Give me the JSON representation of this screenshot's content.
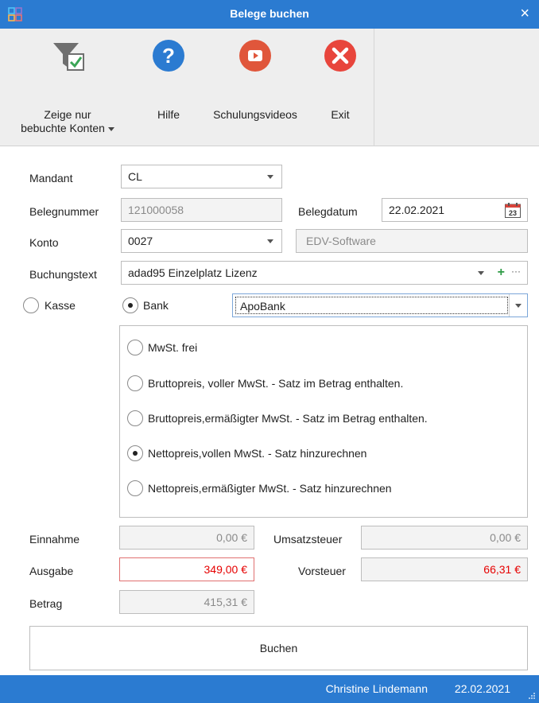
{
  "window": {
    "title": "Belege buchen",
    "close_glyph": "×"
  },
  "toolbar": {
    "show_booked": {
      "line1": "Zeige nur",
      "line2": "bebuchte Konten",
      "icon": "filter-check-icon"
    },
    "help": {
      "label": "Hilfe",
      "icon": "help-icon"
    },
    "videos": {
      "label": "Schulungsvideos",
      "icon": "video-play-icon"
    },
    "exit": {
      "label": "Exit",
      "icon": "exit-icon"
    }
  },
  "form": {
    "mandant": {
      "label": "Mandant",
      "value": "CL"
    },
    "belegnummer": {
      "label": "Belegnummer",
      "value": "121000058"
    },
    "belegdatum": {
      "label": "Belegdatum",
      "value": "22.02.2021",
      "calendar_day": "23"
    },
    "konto": {
      "label": "Konto",
      "value": "0027",
      "name": "EDV-Software"
    },
    "buchungstext": {
      "label": "Buchungstext",
      "value": "adad95 Einzelplatz Lizenz",
      "add_glyph": "+",
      "more_glyph": "···"
    },
    "payment": {
      "kasse_label": "Kasse",
      "bank_label": "Bank",
      "selected": "Bank",
      "bank_value": "ApoBank"
    },
    "vat_options": [
      {
        "label": "MwSt. frei",
        "checked": false
      },
      {
        "label": "Bruttopreis, voller MwSt. - Satz im Betrag enthalten.",
        "checked": false
      },
      {
        "label": "Bruttopreis,ermäßigter MwSt. - Satz im Betrag enthalten.",
        "checked": false
      },
      {
        "label": "Nettopreis,vollen MwSt. - Satz hinzurechnen",
        "checked": true
      },
      {
        "label": "Nettopreis,ermäßigter MwSt. - Satz hinzurechnen",
        "checked": false
      }
    ],
    "einnahme": {
      "label": "Einnahme",
      "value": "0,00 €"
    },
    "umsatzsteuer": {
      "label": "Umsatzsteuer",
      "value": "0,00 €"
    },
    "ausgabe": {
      "label": "Ausgabe",
      "value": "349,00 €"
    },
    "vorsteuer": {
      "label": "Vorsteuer",
      "value": "66,31 €"
    },
    "betrag": {
      "label": "Betrag",
      "value": "415,31 €"
    },
    "submit_label": "Buchen"
  },
  "status": {
    "user": "Christine Lindemann",
    "date": "22.02.2021"
  },
  "colors": {
    "accent": "#2b7bd1",
    "red": "#e60000",
    "help_blue": "#2b7bd1",
    "video_red": "#e0563b",
    "exit_red": "#e8453c"
  }
}
